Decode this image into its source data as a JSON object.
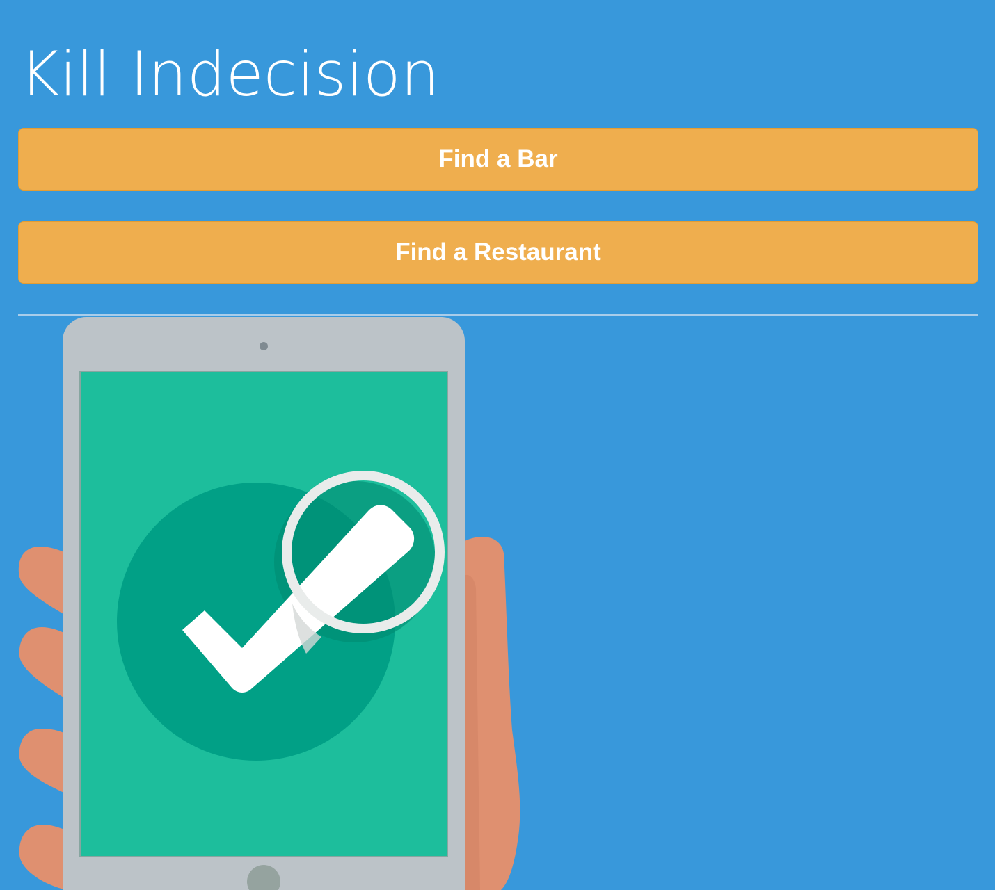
{
  "header": {
    "title": "Kill Indecision"
  },
  "actions": {
    "find_bar_label": "Find a Bar",
    "find_restaurant_label": "Find a Restaurant"
  },
  "illustration": {
    "icon": "tablet-checkmark-icon"
  },
  "colors": {
    "background": "#3898db",
    "button": "#efae4e",
    "screen": "#1dbe9c",
    "check_circle": "#01a086"
  }
}
